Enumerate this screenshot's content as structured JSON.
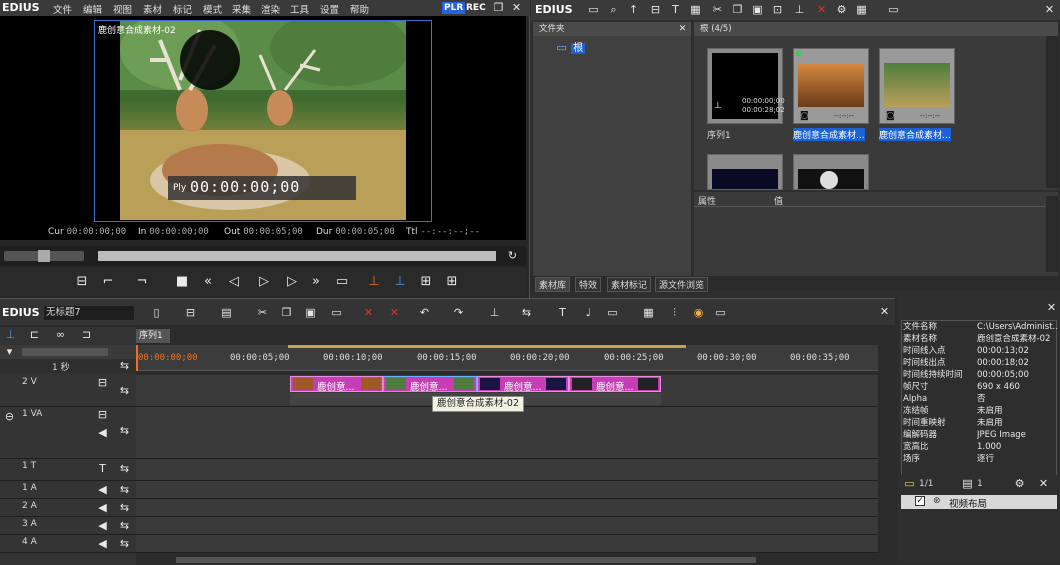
{
  "player": {
    "brand": "EDIUS",
    "menu": [
      "文件",
      "编辑",
      "视图",
      "素材",
      "标记",
      "模式",
      "采集",
      "渲染",
      "工具",
      "设置",
      "帮助"
    ],
    "badge_plr": "PLR",
    "badge_rec": "REC",
    "clip_caption": "鹿创意合成素材-02",
    "ply_label": "Ply",
    "timecode": "00:00:00;00",
    "cur_label": "Cur",
    "cur_value": "00:00:00;00",
    "in_label": "In",
    "in_value": "00:00:00;00",
    "out_label": "Out",
    "out_value": "00:00:05;00",
    "dur_label": "Dur",
    "dur_value": "00:00:05;00",
    "ttl_label": "Ttl",
    "ttl_value": "--:--:--;--"
  },
  "bin": {
    "brand": "EDIUS",
    "folder_header": "文件夹",
    "root_label": "根",
    "asset_header": "根 (4/5)",
    "thumbs": [
      {
        "label": "序列1",
        "tc1": "00:00:00;00",
        "tc2": "00:00:28;02"
      },
      {
        "label": "鹿创意合成素材...",
        "tc1": "--:--:--",
        "tc2": ""
      },
      {
        "label": "鹿创意合成素材...",
        "tc1": "--:--:--",
        "tc2": ""
      }
    ],
    "prop_col1": "属性",
    "prop_col2": "值",
    "tabs": [
      "素材库",
      "特效",
      "素材标记",
      "源文件浏览"
    ]
  },
  "timeline": {
    "brand": "EDIUS",
    "project_name": "无标题7",
    "sequence_tab": "序列1",
    "zoom_label": "1 秒",
    "ruler_ticks": [
      "00:00:00;00",
      "00:00:05;00",
      "00:00:10;00",
      "00:00:15;00",
      "00:00:20;00",
      "00:00:25;00",
      "00:00:30;00",
      "00:00:35;00"
    ],
    "tracks": [
      {
        "name": "2 V"
      },
      {
        "name": "1 VA"
      },
      {
        "name": "1 T"
      },
      {
        "name": "1 A"
      },
      {
        "name": "2 A"
      },
      {
        "name": "3 A"
      },
      {
        "name": "4 A"
      }
    ],
    "clips": [
      "鹿创意...",
      "鹿创意...",
      "鹿创意...",
      "鹿创意..."
    ],
    "tooltip": "鹿创意合成素材-02"
  },
  "info": {
    "rows": [
      {
        "k": "文件名称",
        "v": "C:\\Users\\Administ..."
      },
      {
        "k": "素材名称",
        "v": "鹿创意合成素材-02"
      },
      {
        "k": "时间线入点",
        "v": "00:00:13;02"
      },
      {
        "k": "时间线出点",
        "v": "00:00:18;02"
      },
      {
        "k": "时间线持续时间",
        "v": "00:00:05;00"
      },
      {
        "k": "帧尺寸",
        "v": "690 x 460"
      },
      {
        "k": "Alpha",
        "v": "否"
      },
      {
        "k": "冻结帧",
        "v": "未启用"
      },
      {
        "k": "时间重映射",
        "v": "未启用"
      },
      {
        "k": "编解码器",
        "v": "JPEG Image"
      },
      {
        "k": "宽高比",
        "v": "1.000"
      },
      {
        "k": "场序",
        "v": "逐行"
      }
    ],
    "layer_count": "1/1",
    "layer_num": "1",
    "layer_item": "视频布局"
  },
  "colors": {
    "clip": "#c63db5",
    "selection": "#1c62d6",
    "accent_plr": "#2a62d8"
  }
}
